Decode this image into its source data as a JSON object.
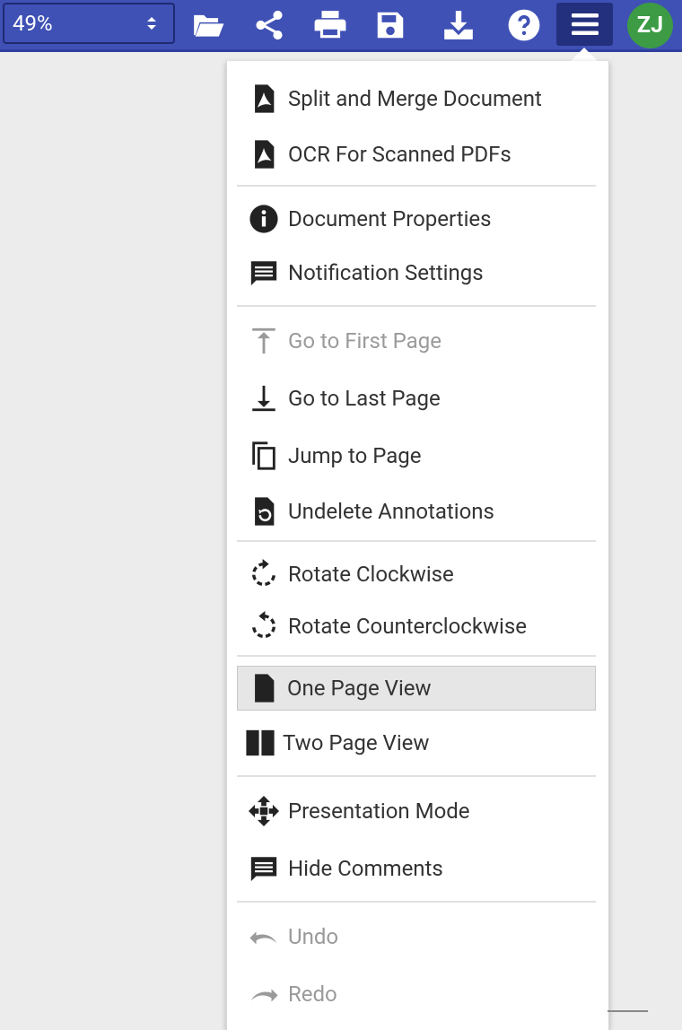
{
  "toolbar": {
    "zoom_value": "49%",
    "buttons": [
      "open-folder",
      "share",
      "print",
      "save",
      "download",
      "help",
      "menu"
    ],
    "avatar_initials": "ZJ",
    "colors": {
      "bar": "#3f51b5",
      "active": "#23307d",
      "avatar": "#3c9b44"
    }
  },
  "menu": {
    "items": [
      {
        "label": "Split and Merge Document",
        "icon": "pdf-file-icon"
      },
      {
        "label": "OCR For Scanned PDFs",
        "icon": "pdf-file-icon"
      },
      {
        "label": "Document Properties",
        "icon": "info-icon"
      },
      {
        "label": "Notification Settings",
        "icon": "comment-icon"
      },
      {
        "label": "Go to First Page",
        "icon": "arrow-up-bar-icon",
        "disabled": true
      },
      {
        "label": "Go to Last Page",
        "icon": "arrow-down-bar-icon"
      },
      {
        "label": "Jump to Page",
        "icon": "copy-pages-icon"
      },
      {
        "label": "Undelete Annotations",
        "icon": "file-restore-icon"
      },
      {
        "label": "Rotate Clockwise",
        "icon": "rotate-clockwise-icon"
      },
      {
        "label": "Rotate Counterclockwise",
        "icon": "rotate-counterclockwise-icon"
      },
      {
        "label": "One Page View",
        "icon": "single-page-icon",
        "selected": true
      },
      {
        "label": "Two Page View",
        "icon": "two-page-icon"
      },
      {
        "label": "Presentation Mode",
        "icon": "move-arrows-icon"
      },
      {
        "label": "Hide Comments",
        "icon": "comment-icon"
      },
      {
        "label": "Undo",
        "icon": "undo-icon",
        "disabled": true
      },
      {
        "label": "Redo",
        "icon": "redo-icon",
        "disabled": true
      }
    ]
  }
}
